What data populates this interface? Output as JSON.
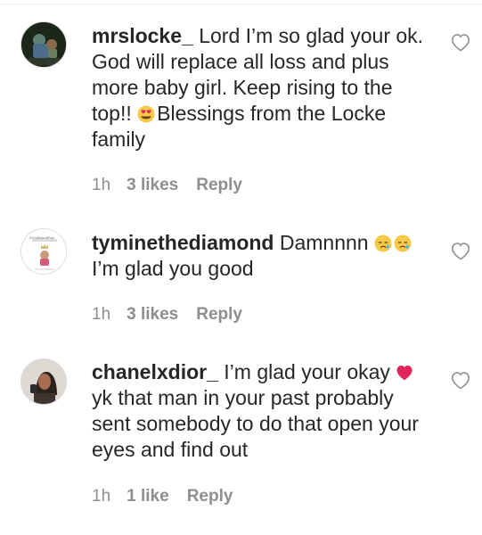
{
  "comments": [
    {
      "username": "mrslocke_",
      "text_before_emoji": " Lord I’m so glad your ok. God will replace all loss and plus more baby girl. Keep rising to the top!! ",
      "emoji": "heart-eyes-emoji",
      "text_after_emoji": "Blessings from the Locke family",
      "time": "1h",
      "likes": "3 likes",
      "reply": "Reply",
      "avatar": "avatar-photo"
    },
    {
      "username": "tyminethediamond",
      "text_before_emoji": " Damnnnn ",
      "emoji": "crying-face-emoji",
      "text_after_emoji": "I’m glad you good",
      "time": "1h",
      "likes": "3 likes",
      "reply": "Reply",
      "avatar_caption": "#YouBeenAFan"
    },
    {
      "username": "chanelxdior_",
      "text_before_emoji": " I’m glad your okay ",
      "emoji": "red-heart-emoji",
      "text_after_emoji": "yk that man in your past probably sent somebody to do that open your eyes and find out",
      "time": "1h",
      "likes": "1 like",
      "reply": "Reply",
      "avatar": "avatar-photo"
    }
  ],
  "colors": {
    "text": "#262626",
    "meta": "#8e8e8e",
    "divider": "#efefef",
    "heart_outline": "#8e8e8e",
    "red_heart": "#e0245e",
    "emoji_yellow": "#f7c948"
  },
  "icons": {
    "like": "heart-outline-icon"
  }
}
